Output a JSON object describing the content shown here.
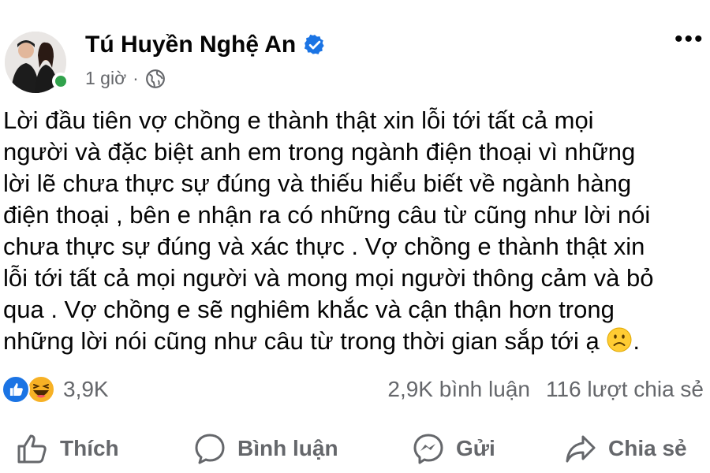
{
  "post": {
    "author": "Tú Huyền Nghệ An",
    "time": "1 giờ",
    "separator": "·",
    "more_icon": "•••",
    "lines": [
      "Lời đầu tiên vợ chồng e thành thật xin lỗi tới tất cả mọi",
      "người và đặc biệt anh em trong ngành điện thoại vì những",
      "lời lẽ chưa thực sự đúng và thiếu hiểu biết về ngành hàng",
      "điện thoại , bên e nhận ra có những câu từ cũng như lời nói",
      "chưa thực sự đúng và xác thực . Vợ chồng e thành thật xin",
      "lỗi tới tất cả mọi người và mong mọi người thông cảm và bỏ",
      "qua . Vợ chồng e sẽ nghiêm khắc và cận thận hơn trong",
      "những lời nói cũng như câu từ trong thời gian sắp tới ạ"
    ],
    "last_line_end": "."
  },
  "stats": {
    "reactions": "3,9K",
    "comments": "2,9K bình luận",
    "shares": "116 lượt chia sẻ"
  },
  "actions": {
    "like": "Thích",
    "comment": "Bình luận",
    "send": "Gửi",
    "share": "Chia sẻ"
  },
  "colors": {
    "accent": "#1b74e4",
    "muted": "#65676b",
    "online": "#31a24c",
    "haha": "#f7b125"
  },
  "icons": [
    "verified-badge-icon",
    "globe-icon",
    "more-options-icon",
    "like-reaction-icon",
    "haha-reaction-icon",
    "frowning-face-emoji",
    "like-icon",
    "comment-icon",
    "messenger-icon",
    "share-icon"
  ]
}
